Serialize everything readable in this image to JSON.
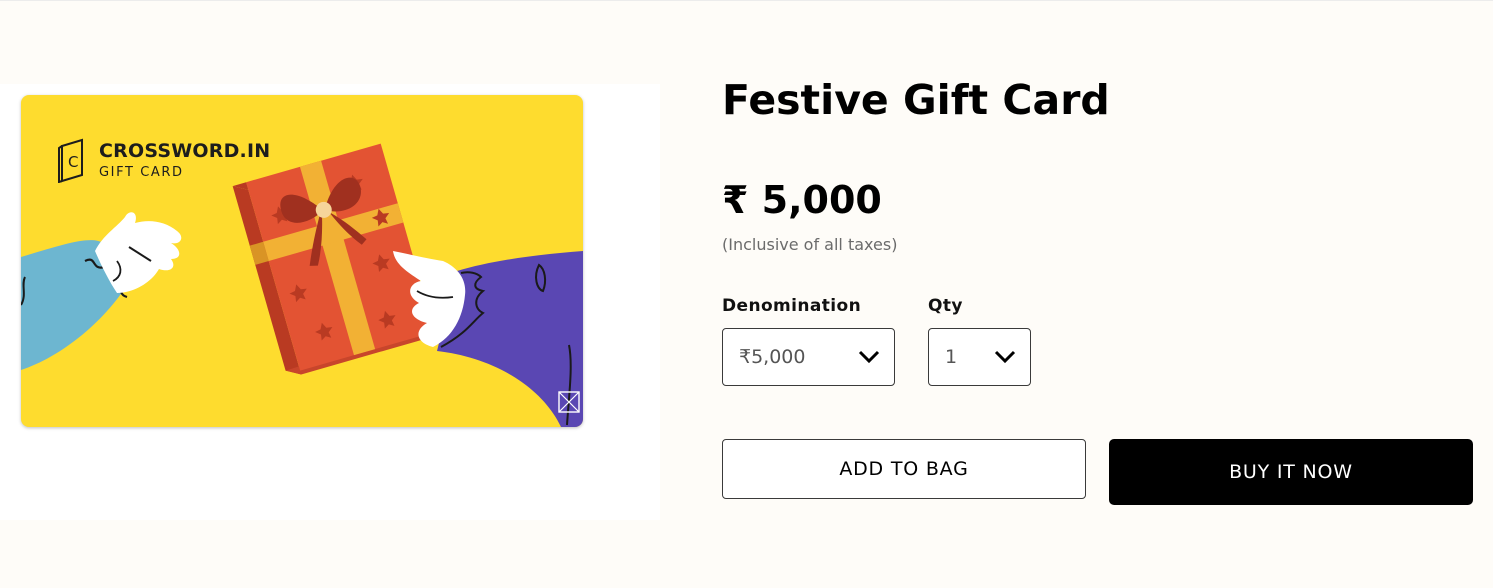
{
  "product": {
    "title": "Festive Gift Card",
    "price": "₹ 5,000",
    "tax_note": "(Inclusive of all taxes)"
  },
  "card": {
    "brand_name": "CROSSWORD.IN",
    "brand_subtitle": "GIFT CARD",
    "logo_letter": "C",
    "background_color": "#fedc2e"
  },
  "options": {
    "denomination": {
      "label": "Denomination",
      "selected": "₹5,000"
    },
    "quantity": {
      "label": "Qty",
      "selected": "1"
    }
  },
  "actions": {
    "add_to_bag": "ADD TO BAG",
    "buy_now": "BUY IT NOW"
  },
  "colors": {
    "primary_button": "#000000",
    "card_yellow": "#fedc2e",
    "gift_red": "#e35333",
    "ribbon": "#f2b134",
    "sleeve_blue": "#6db6d0",
    "sleeve_purple": "#5a47b3"
  },
  "icons": {
    "dropdown": "chevron-down-icon",
    "broken_image": "broken-image-icon",
    "logo": "book-logo-icon"
  }
}
